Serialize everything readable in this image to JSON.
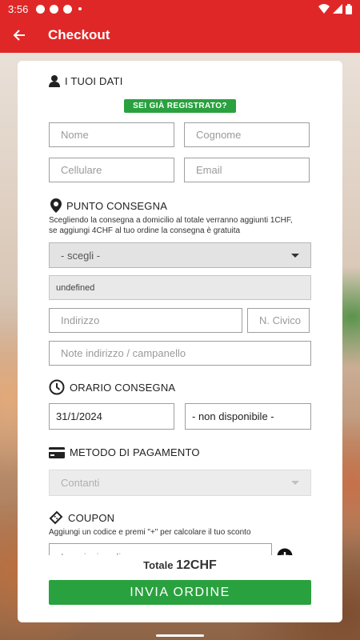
{
  "status_bar": {
    "time": "3:56"
  },
  "app_bar": {
    "title": "Checkout"
  },
  "dati": {
    "heading": "I TUOI DATI",
    "registered_label": "SEI GIÀ REGISTRATO?",
    "nome_placeholder": "Nome",
    "cognome_placeholder": "Cognome",
    "cellulare_placeholder": "Cellulare",
    "email_placeholder": "Email"
  },
  "consegna": {
    "heading": "PUNTO CONSEGNA",
    "note_line1": "Scegliendo la consegna a domicilio al totale verranno aggiunti 1CHF,",
    "note_line2": "se aggiungi 4CHF al tuo ordine la consegna è gratuita",
    "select_value": "- scegli -",
    "undefined_value": "undefined",
    "indirizzo_placeholder": "Indirizzo",
    "civico_placeholder": "N. Civico",
    "note_placeholder": "Note indirizzo / campanello"
  },
  "orario": {
    "heading": "ORARIO CONSEGNA",
    "date_value": "31/1/2024",
    "time_value": "- non disponibile -"
  },
  "pagamento": {
    "heading": "METODO DI PAGAMENTO",
    "select_value": "Contanti"
  },
  "coupon": {
    "heading": "COUPON",
    "note": "Aggiungi un codice e premi \"+\" per calcolare il tuo sconto",
    "placeholder": "Inserisci codice coupon"
  },
  "totale": {
    "label": "Totale",
    "amount": "12CHF"
  },
  "submit_label": "INVIA ORDINE",
  "colors": {
    "brand_red": "#e02727",
    "accent_green": "#2aa13f"
  }
}
